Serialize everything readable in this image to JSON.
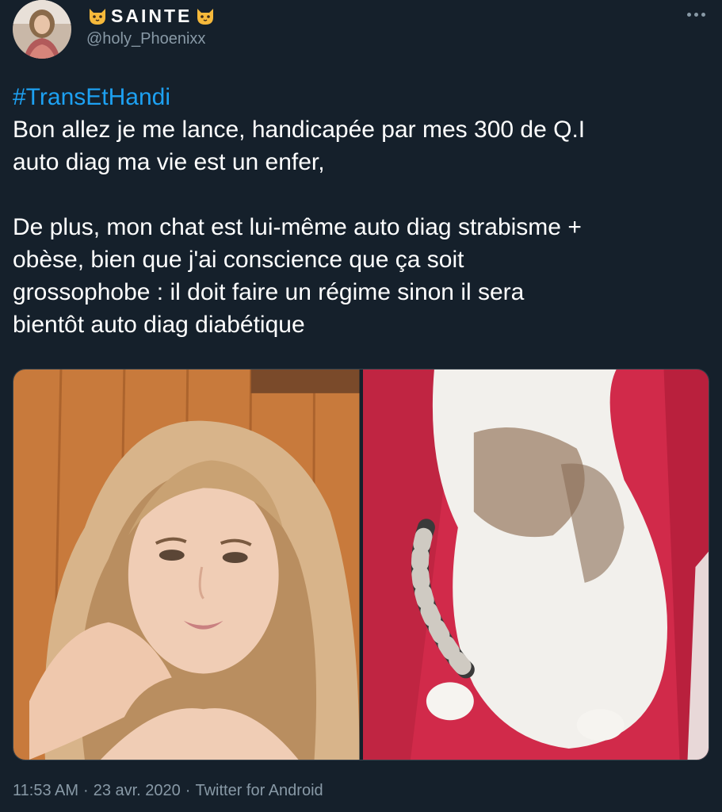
{
  "user": {
    "display_name": "SAINTE",
    "handle": "@holy_Phoenixx",
    "name_emoji": "cat-face-icon"
  },
  "tweet": {
    "hashtag": "#TransEtHandi",
    "lines": [
      "Bon allez je me lance, handicapée par mes 300 de Q.I",
      "auto diag ma vie est un enfer,",
      "",
      "De plus, mon chat est lui-même auto diag strabisme +",
      "obèse, bien que j'ai conscience que ça soit",
      "grossophobe : il doit faire un régime sinon il sera",
      "bientôt auto diag diabétique"
    ]
  },
  "footer": {
    "time": "11:53 AM",
    "separator": "·",
    "date": "23 avr. 2020",
    "source": "Twitter for Android"
  },
  "colors": {
    "background": "#15202b",
    "link": "#1da1f2",
    "secondary_text": "#8899a6"
  }
}
